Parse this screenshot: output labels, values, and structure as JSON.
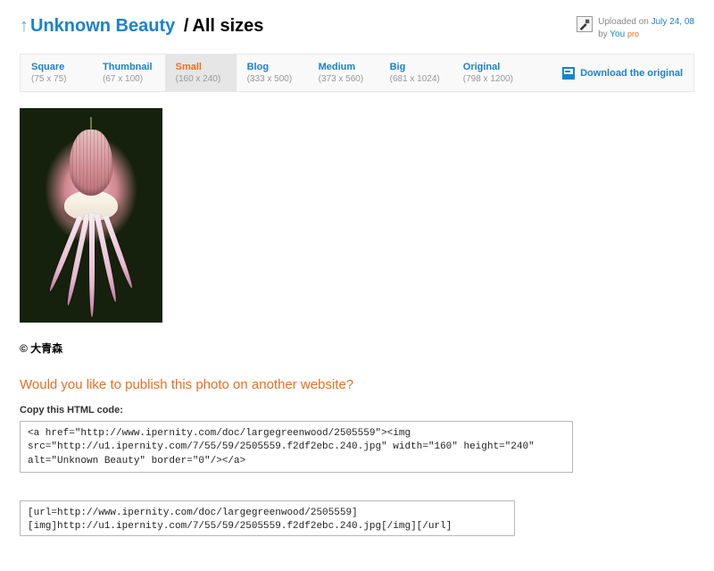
{
  "header": {
    "arrow": "↑",
    "title_link": "Unknown Beauty",
    "separator": "/",
    "all_sizes": "All sizes"
  },
  "meta": {
    "uploaded_prefix": "Uploaded on",
    "uploaded_date": "July 24, 08",
    "by_prefix": "by",
    "by_you": "You",
    "pro": "pro"
  },
  "sizes": [
    {
      "label": "Square",
      "dim": "(75 x 75)"
    },
    {
      "label": "Thumbnail",
      "dim": "(67 x 100)"
    },
    {
      "label": "Small",
      "dim": "(160 x 240)"
    },
    {
      "label": "Blog",
      "dim": "(333 x 500)"
    },
    {
      "label": "Medium",
      "dim": "(373 x 560)"
    },
    {
      "label": "Big",
      "dim": "(681 x 1024)"
    },
    {
      "label": "Original",
      "dim": "(798 x 1200)"
    }
  ],
  "download_label": "Download the original",
  "copyright": "© 大青森",
  "publish_question": "Would you like to publish this photo on another website?",
  "copy_label": "Copy this HTML code:",
  "embed_html": "<a href=\"http://www.ipernity.com/doc/largegreenwood/2505559\"><img src=\"http://u1.ipernity.com/7/55/59/2505559.f2df2ebc.240.jpg\" width=\"160\" height=\"240\" alt=\"Unknown Beauty\" border=\"0\"/></a>",
  "embed_bbcode": "[url=http://www.ipernity.com/doc/largegreenwood/2505559][img]http://u1.ipernity.com/7/55/59/2505559.f2df2ebc.240.jpg[/img][/url]"
}
